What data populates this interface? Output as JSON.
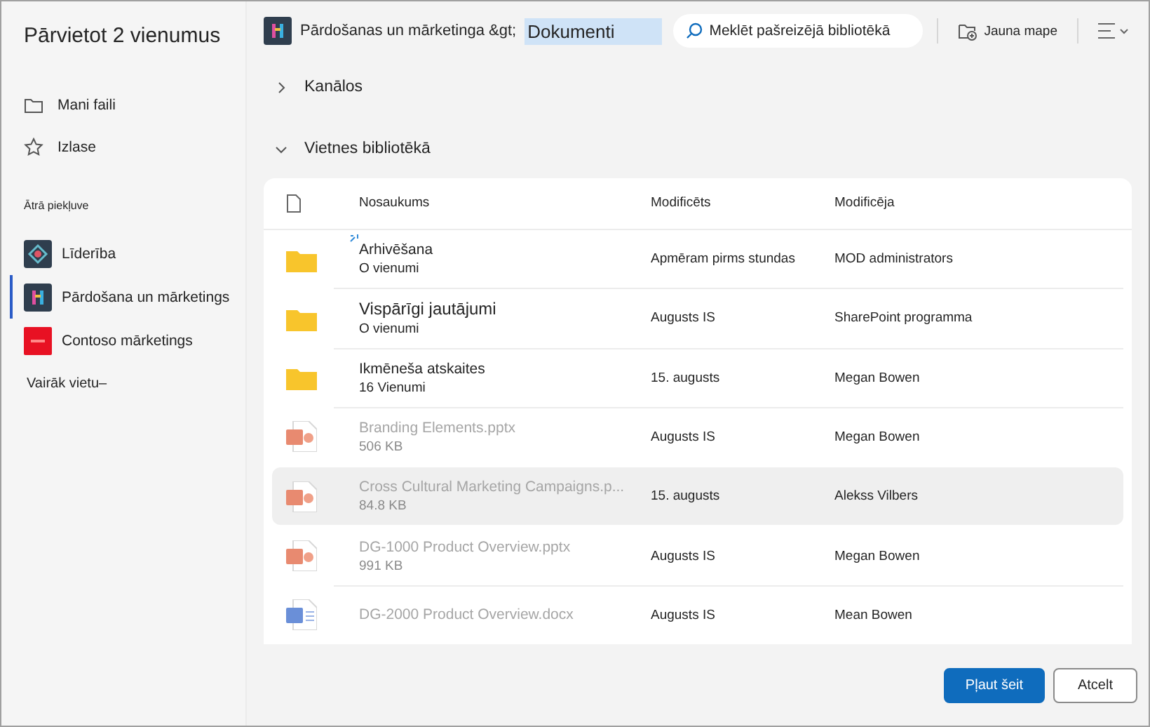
{
  "sidebar": {
    "title": "Pārvietot 2 vienumus",
    "nav": [
      {
        "label": "Mani faili",
        "kind": "folder"
      },
      {
        "label": "Izlase",
        "kind": "star"
      }
    ],
    "quick_access_heading": "Ātrā piekļuve",
    "quick_access": [
      {
        "label": "Līderība",
        "kind": "leadership",
        "selected": false
      },
      {
        "label": "Pārdošana un mārketings",
        "kind": "sales",
        "selected": true
      },
      {
        "label": "Contoso mārketings",
        "kind": "contoso",
        "selected": false
      }
    ],
    "more_link": "Vairāk vietu–"
  },
  "toolbar": {
    "breadcrumb": "Pārdošanas un mārketinga &gt;",
    "current": "Dokumenti",
    "search": {
      "placeholder": "Meklēt pašreizējā bibliotēkā"
    },
    "new_folder": "Jauna mape"
  },
  "sections": [
    {
      "label": "Kanālos",
      "expanded": false
    },
    {
      "label": "Vietnes bibliotēkā",
      "expanded": true
    }
  ],
  "table": {
    "columns": [
      "Nosaukums",
      "Modificēts",
      "Modificēja"
    ],
    "rows": [
      {
        "kind": "folder",
        "name": "Arhivēšana",
        "meta": "O vienumi",
        "modified": "Apmēram pirms stundas",
        "by": "MOD administrators",
        "disabled": false,
        "selected": false,
        "is_new": true
      },
      {
        "kind": "folder",
        "name": "Vispārīgi jautājumi",
        "meta": "O vienumi",
        "modified": "Augusts IS",
        "by": "SharePoint programma",
        "disabled": false,
        "selected": false,
        "is_new": false
      },
      {
        "kind": "folder",
        "name": "Ikmēneša atskaites",
        "meta": "16 Vienumi",
        "modified": "15. augusts",
        "by": "Megan Bowen",
        "disabled": false,
        "selected": false,
        "is_new": false
      },
      {
        "kind": "pptx",
        "name": "Branding Elements.pptx",
        "meta": "506 KB",
        "modified": "Augusts  IS",
        "by": "Megan Bowen",
        "disabled": true,
        "selected": false,
        "is_new": false
      },
      {
        "kind": "pptx",
        "name": "Cross Cultural Marketing Campaigns.p...",
        "meta": "84.8 KB",
        "modified": "15. augusts",
        "by": "Alekss Vilbers",
        "disabled": true,
        "selected": true,
        "is_new": false
      },
      {
        "kind": "pptx",
        "name": "DG-1000 Product Overview.pptx",
        "meta": "991 KB",
        "modified": "Augusts IS",
        "by": "Megan Bowen",
        "disabled": true,
        "selected": false,
        "is_new": false
      },
      {
        "kind": "docx",
        "name": "DG-2000 Product Overview.docx",
        "modified": "Augusts IS",
        "by": "Mean Bowen",
        "disabled": true,
        "selected": false,
        "is_new": false
      }
    ]
  },
  "buttons": [
    {
      "label": "Pļaut šeit",
      "kind": "primary"
    },
    {
      "label": "Atcelt",
      "kind": "secondary"
    }
  ]
}
